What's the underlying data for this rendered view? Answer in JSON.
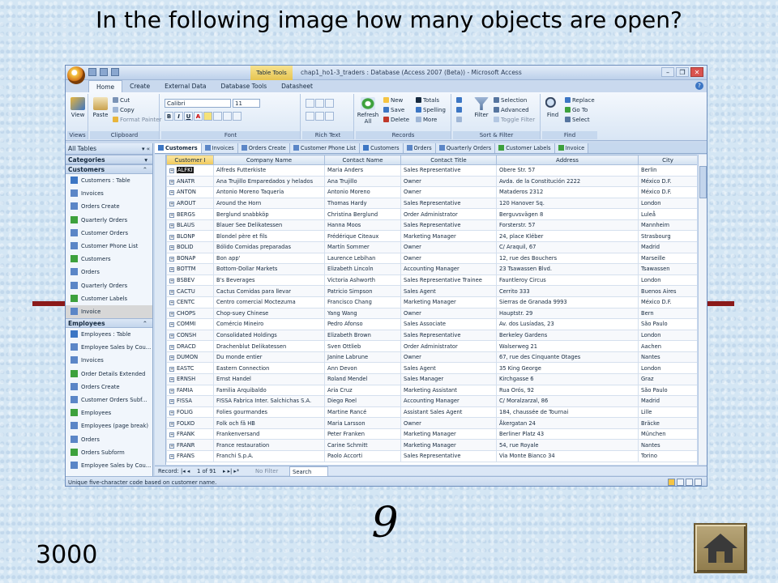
{
  "slide": {
    "question": "In the following image how many objects are open?",
    "answer": "9",
    "points": "3000"
  },
  "colors": {
    "slide_background": "#d4e6f4",
    "rule": "#8b1a1a",
    "ribbon_blue": "#c9d9ee",
    "table_tools": "#e6c451"
  },
  "access": {
    "table_tools": "Table Tools",
    "title": "chap1_ho1-3_traders : Database (Access 2007 (Beta)) - Microsoft Access",
    "window_controls": {
      "minimize": "–",
      "maximize": "❐",
      "close": "✕"
    },
    "ribbon_tabs": [
      "Home",
      "Create",
      "External Data",
      "Database Tools",
      "Datasheet"
    ],
    "ribbon": {
      "views": {
        "label": "Views",
        "view": "View"
      },
      "clipboard": {
        "label": "Clipboard",
        "paste": "Paste",
        "cut": "Cut",
        "copy": "Copy",
        "format_painter": "Format Painter"
      },
      "font": {
        "label": "Font",
        "name": "Calibri",
        "size": "11",
        "bold": "B",
        "italic": "I",
        "underline": "U",
        "color": "A"
      },
      "rich_text": {
        "label": "Rich Text"
      },
      "records": {
        "label": "Records",
        "refresh": "Refresh All",
        "new": "New",
        "save": "Save",
        "delete": "Delete",
        "totals": "Totals",
        "spelling": "Spelling",
        "more": "More"
      },
      "sort_filter": {
        "label": "Sort & Filter",
        "filter": "Filter",
        "selection": "Selection",
        "advanced": "Advanced",
        "toggle": "Toggle Filter"
      },
      "find": {
        "label": "Find",
        "find": "Find",
        "replace": "Replace",
        "goto": "Go To",
        "select": "Select"
      }
    },
    "nav": {
      "header": "All Tables",
      "categories": "Categories",
      "groups": [
        {
          "name": "Customers",
          "items": [
            "Customers : Table",
            "Invoices",
            "Orders Create",
            "Quarterly Orders",
            "Customer Orders",
            "Customer Phone List",
            "Customers",
            "Orders",
            "Quarterly Orders",
            "Customer Labels",
            "Invoice"
          ]
        },
        {
          "name": "Employees",
          "items": [
            "Employees : Table",
            "Employee Sales by Cou...",
            "Invoices",
            "Order Details Extended",
            "Orders Create",
            "Customer Orders Subf...",
            "Employees",
            "Employees (page break)",
            "Orders",
            "Orders Subform",
            "Employee Sales by Cou..."
          ]
        }
      ]
    },
    "doc_tabs": [
      "Customers",
      "Invoices",
      "Orders Create",
      "Customer Phone List",
      "Customers",
      "Orders",
      "Quarterly Orders",
      "Customer Labels",
      "Invoice"
    ],
    "columns": [
      "Customer I",
      "Company Name",
      "Contact Name",
      "Contact Title",
      "Address",
      "City"
    ],
    "rows": [
      [
        "ALFKI",
        "Alfreds Futterkiste",
        "Maria Anders",
        "Sales Representative",
        "Obere Str. 57",
        "Berlin"
      ],
      [
        "ANATR",
        "Ana Trujillo Emparedados y helados",
        "Ana Trujillo",
        "Owner",
        "Avda. de la Constitución 2222",
        "México D.F."
      ],
      [
        "ANTON",
        "Antonio Moreno Taquería",
        "Antonio Moreno",
        "Owner",
        "Mataderos  2312",
        "México D.F."
      ],
      [
        "AROUT",
        "Around the Horn",
        "Thomas Hardy",
        "Sales Representative",
        "120 Hanover Sq.",
        "London"
      ],
      [
        "BERGS",
        "Berglund snabbköp",
        "Christina Berglund",
        "Order Administrator",
        "Berguvsvägen  8",
        "Luleå"
      ],
      [
        "BLAUS",
        "Blauer See Delikatessen",
        "Hanna Moos",
        "Sales Representative",
        "Forsterstr. 57",
        "Mannheim"
      ],
      [
        "BLONP",
        "Blondel père et fils",
        "Frédérique Citeaux",
        "Marketing Manager",
        "24, place Kléber",
        "Strasbourg"
      ],
      [
        "BOLID",
        "Bólido Comidas preparadas",
        "Martín Sommer",
        "Owner",
        "C/ Araquil, 67",
        "Madrid"
      ],
      [
        "BONAP",
        "Bon app'",
        "Laurence Lebihan",
        "Owner",
        "12, rue des Bouchers",
        "Marseille"
      ],
      [
        "BOTTM",
        "Bottom-Dollar Markets",
        "Elizabeth Lincoln",
        "Accounting Manager",
        "23 Tsawassen Blvd.",
        "Tsawassen"
      ],
      [
        "BSBEV",
        "B's Beverages",
        "Victoria Ashworth",
        "Sales Representative Trainee",
        "Fauntleroy Circus",
        "London"
      ],
      [
        "CACTU",
        "Cactus Comidas para llevar",
        "Patricio Simpson",
        "Sales Agent",
        "Cerrito 333",
        "Buenos Aires"
      ],
      [
        "CENTC",
        "Centro comercial Moctezuma",
        "Francisco Chang",
        "Marketing Manager",
        "Sierras de Granada 9993",
        "México D.F."
      ],
      [
        "CHOPS",
        "Chop-suey Chinese",
        "Yang Wang",
        "Owner",
        "Hauptstr. 29",
        "Bern"
      ],
      [
        "COMMI",
        "Comércio Mineiro",
        "Pedro Afonso",
        "Sales Associate",
        "Av. dos Lusíadas, 23",
        "São Paulo"
      ],
      [
        "CONSH",
        "Consolidated Holdings",
        "Elizabeth Brown",
        "Sales Representative",
        "Berkeley Gardens",
        "London"
      ],
      [
        "DRACD",
        "Drachenblut Delikatessen",
        "Sven Ottlieb",
        "Order Administrator",
        "Walserweg 21",
        "Aachen"
      ],
      [
        "DUMON",
        "Du monde entier",
        "Janine Labrune",
        "Owner",
        "67, rue des Cinquante Otages",
        "Nantes"
      ],
      [
        "EASTC",
        "Eastern Connection",
        "Ann Devon",
        "Sales Agent",
        "35 King George",
        "London"
      ],
      [
        "ERNSH",
        "Ernst Handel",
        "Roland Mendel",
        "Sales Manager",
        "Kirchgasse 6",
        "Graz"
      ],
      [
        "FAMIA",
        "Familia Arquibaldo",
        "Aria Cruz",
        "Marketing Assistant",
        "Rua Orós, 92",
        "São Paulo"
      ],
      [
        "FISSA",
        "FISSA Fabrica Inter. Salchichas S.A.",
        "Diego Roel",
        "Accounting Manager",
        "C/ Moralzarzal, 86",
        "Madrid"
      ],
      [
        "FOLIG",
        "Folies gourmandes",
        "Martine Rancé",
        "Assistant Sales Agent",
        "184, chaussée de Tournai",
        "Lille"
      ],
      [
        "FOLKO",
        "Folk och fä HB",
        "Maria Larsson",
        "Owner",
        "Åkergatan 24",
        "Bräcke"
      ],
      [
        "FRANK",
        "Frankenversand",
        "Peter Franken",
        "Marketing Manager",
        "Berliner Platz 43",
        "München"
      ],
      [
        "FRANR",
        "France restauration",
        "Carine Schmitt",
        "Marketing Manager",
        "54, rue Royale",
        "Nantes"
      ],
      [
        "FRANS",
        "Franchi S.p.A.",
        "Paolo Accorti",
        "Sales Representative",
        "Via Monte Bianco 34",
        "Torino"
      ]
    ],
    "record_bar": {
      "label": "Record:",
      "position": "1 of 91",
      "filter": "No Filter",
      "search": "Search"
    },
    "status": "Unique five-character code based on customer name."
  }
}
